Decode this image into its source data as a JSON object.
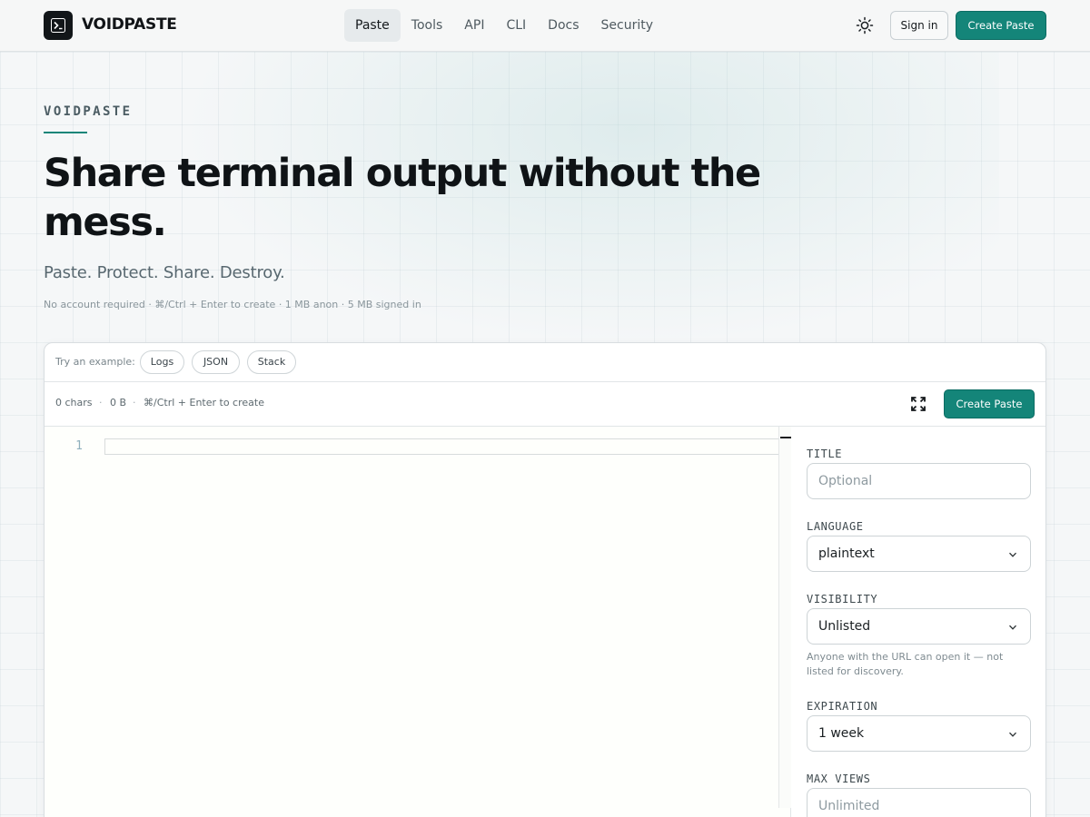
{
  "header": {
    "brand": "VOIDPASTE",
    "nav": [
      "Paste",
      "Tools",
      "API",
      "CLI",
      "Docs",
      "Security"
    ],
    "active_nav": "Paste",
    "signin_label": "Sign in",
    "create_label": "Create Paste"
  },
  "hero": {
    "eyebrow": "VOIDPASTE",
    "title": "Share terminal output without the mess.",
    "subtitle": "Paste. Protect. Share. Destroy.",
    "meta": "No account required · ⌘/Ctrl + Enter to create · 1 MB anon · 5 MB signed in"
  },
  "examples": {
    "label": "Try an example:",
    "chips": [
      "Logs",
      "JSON",
      "Stack"
    ]
  },
  "toolbar": {
    "chars": "0 chars",
    "bytes": "0 B",
    "shortcut": "⌘/Ctrl + Enter to create",
    "separator": "·",
    "create_label": "Create Paste"
  },
  "editor": {
    "line_numbers": [
      "1"
    ]
  },
  "settings": {
    "title": {
      "label": "TITLE",
      "placeholder": "Optional"
    },
    "language": {
      "label": "LANGUAGE",
      "value": "plaintext"
    },
    "visibility": {
      "label": "VISIBILITY",
      "value": "Unlisted",
      "help": "Anyone with the URL can open it — not listed for discovery."
    },
    "expiration": {
      "label": "EXPIRATION",
      "value": "1 week"
    },
    "max_views": {
      "label": "MAX VIEWS",
      "placeholder": "Unlimited"
    }
  },
  "colors": {
    "accent": "#148579",
    "background": "#f5f7f8",
    "text": "#111417"
  }
}
